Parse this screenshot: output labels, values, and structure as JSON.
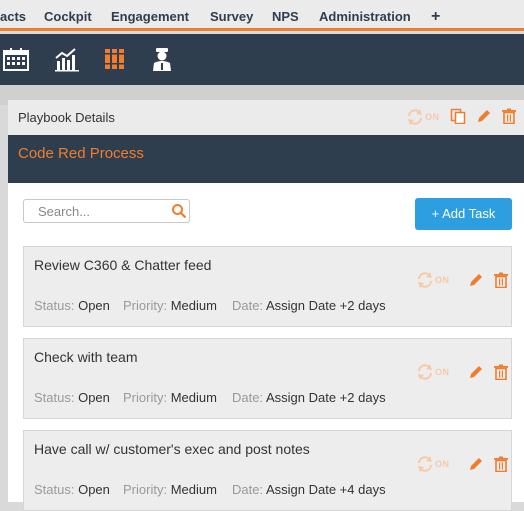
{
  "nav": {
    "items": [
      {
        "label": "acts"
      },
      {
        "label": "Cockpit"
      },
      {
        "label": "Engagement"
      },
      {
        "label": "Survey"
      },
      {
        "label": "NPS"
      },
      {
        "label": "Administration"
      }
    ],
    "add_label": "+"
  },
  "toolbar": {
    "icons": [
      "calendar-icon",
      "chart-icon",
      "playbook-icon",
      "agent-icon"
    ],
    "active_icon": "playbook-icon"
  },
  "playbook": {
    "header_label": "Playbook Details",
    "sync_status": "ON",
    "title": "Code Red Process"
  },
  "search": {
    "placeholder": "Search...",
    "value": ""
  },
  "add_task_label": "+ Add Task",
  "labels": {
    "status": "Status:",
    "priority": "Priority:",
    "date": "Date:",
    "sync": "ON"
  },
  "tasks": [
    {
      "title": "Review C360 & Chatter feed",
      "status": "Open",
      "priority": "Medium",
      "date": "Assign Date +2 days"
    },
    {
      "title": "Check with team",
      "status": "Open",
      "priority": "Medium",
      "date": "Assign Date +2 days"
    },
    {
      "title": "Have call w/ customer's exec and post notes",
      "status": "Open",
      "priority": "Medium",
      "date": "Assign Date +4 days"
    }
  ],
  "colors": {
    "accent": "#f07d2e",
    "dark": "#2f3e4e",
    "button": "#2d9fe0"
  }
}
